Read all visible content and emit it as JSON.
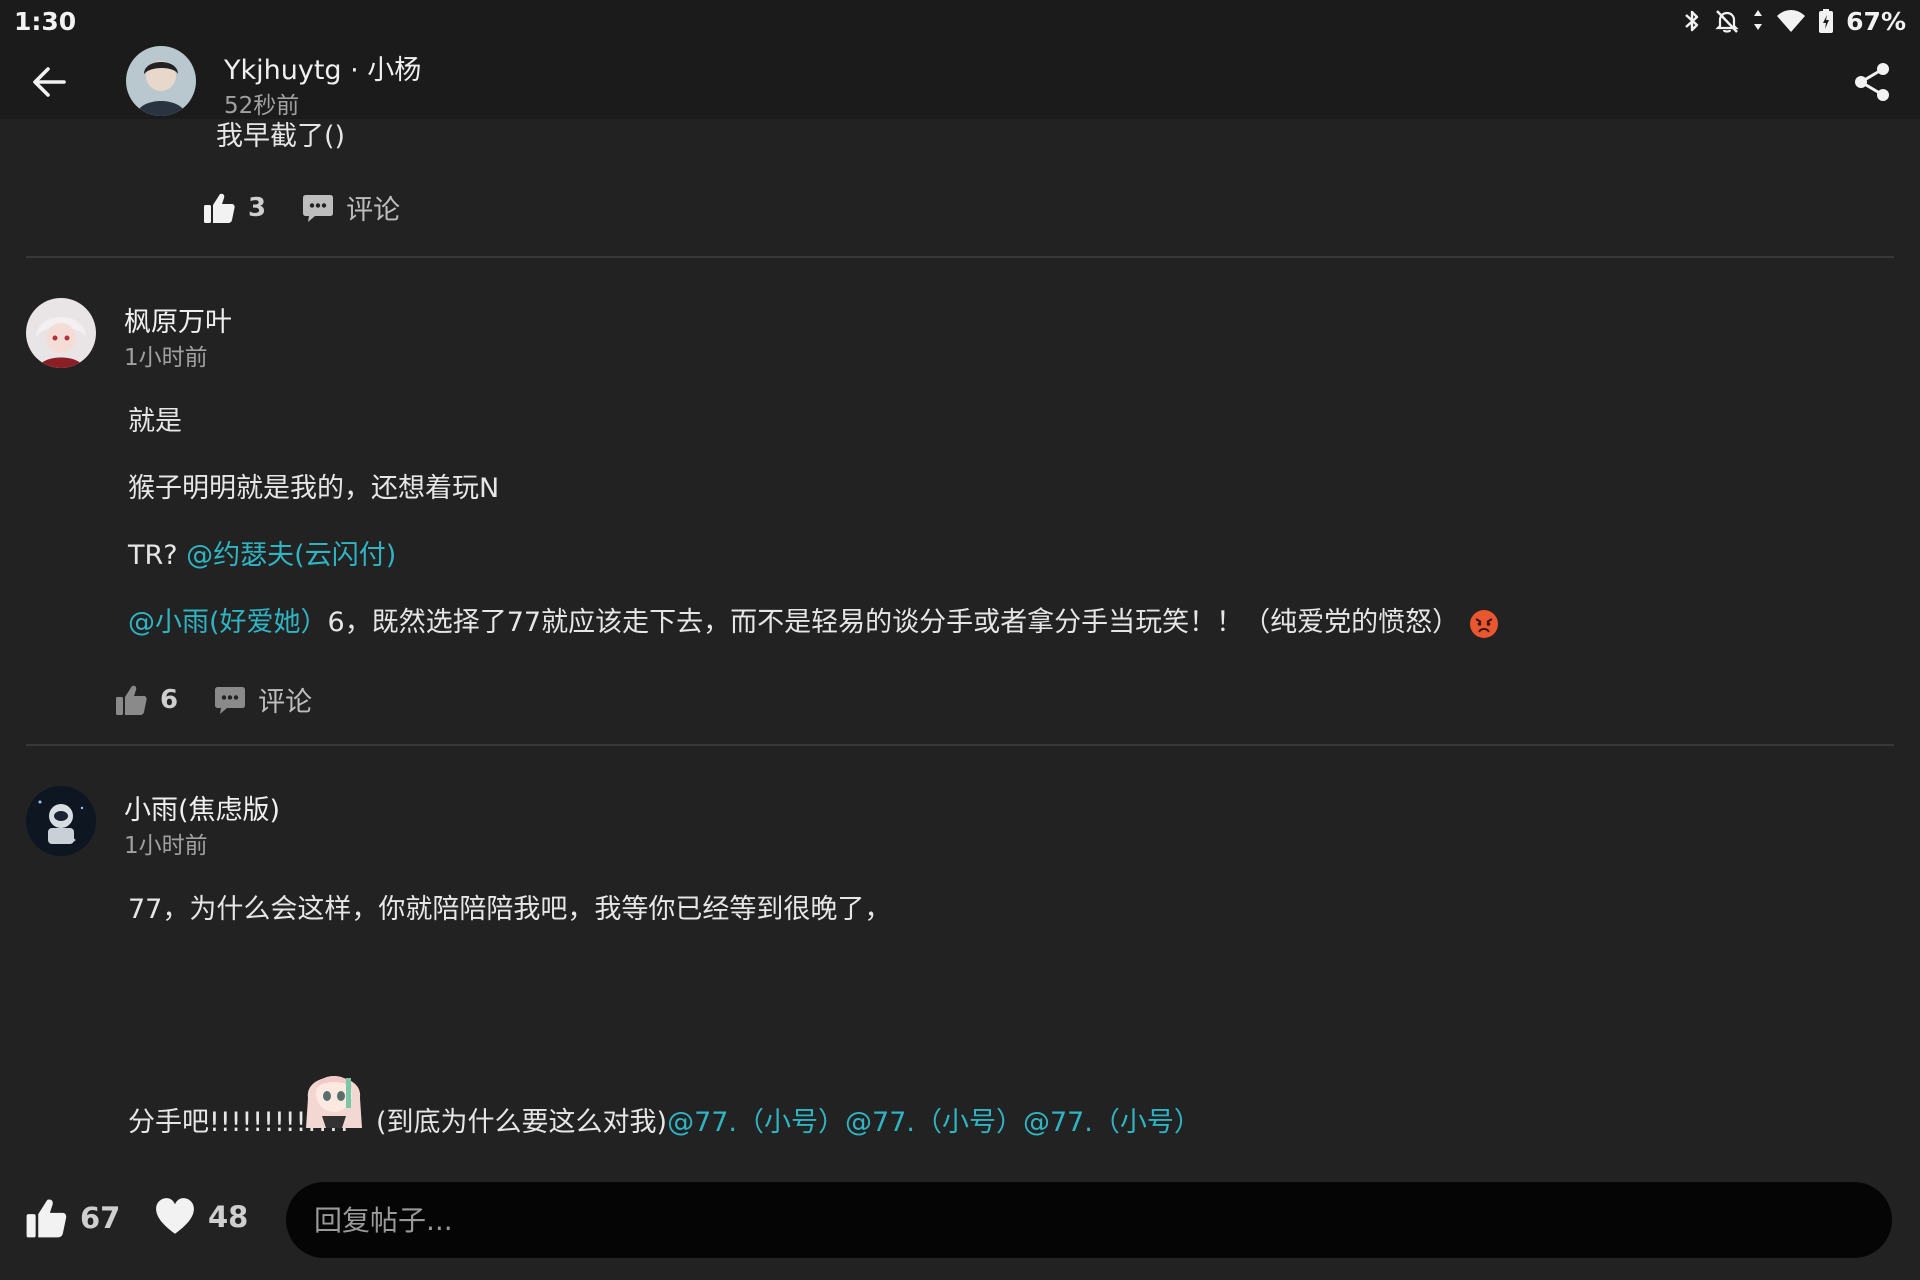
{
  "status_bar": {
    "time": "1:30",
    "battery": "67%",
    "icons": [
      "bluetooth-icon",
      "bell-off-icon",
      "data-arrows-icon",
      "wifi-icon",
      "battery-icon"
    ]
  },
  "header": {
    "author": "Ykjhuytg · 小杨",
    "time": "52秒前",
    "back_icon": "arrow-left-icon",
    "share_icon": "share-icon"
  },
  "reply1": {
    "text": "我早截了()",
    "likes": "3",
    "comment_label": "评论"
  },
  "reply2": {
    "author": "枫原万叶",
    "time": "1小时前",
    "lines": {
      "l1": "就是",
      "l2": "猴子明明就是我的，还想着玩N",
      "l3_prefix": "TR? ",
      "l3_mention": "@约瑟夫(云闪付)",
      "l4_mention": "@小雨(好爱她）",
      "l4_text": "6，既然选择了77就应该走下去，而不是轻易的谈分手或者拿分手当玩笑！！（纯爱党的愤怒）"
    },
    "likes": "6",
    "comment_label": "评论"
  },
  "reply3": {
    "author": "小雨(焦虑版)",
    "time": "1小时前",
    "line1": "77，为什么会这样，你就陪陪陪我吧，我等你已经等到很晚了，",
    "line2_text": "分手吧!!!!!!!!!!!!!",
    "line2_paren": "(到底为什么要这么对我)",
    "line2_mentions": "@77.（小号）@77.（小号）@77.（小号）"
  },
  "bottom_bar": {
    "likes": "67",
    "favorites": "48",
    "reply_placeholder": "回复帖子..."
  },
  "colors": {
    "background": "#222222",
    "bar": "#1b1b1b",
    "mention": "#2fb4c4",
    "divider": "#383838"
  }
}
